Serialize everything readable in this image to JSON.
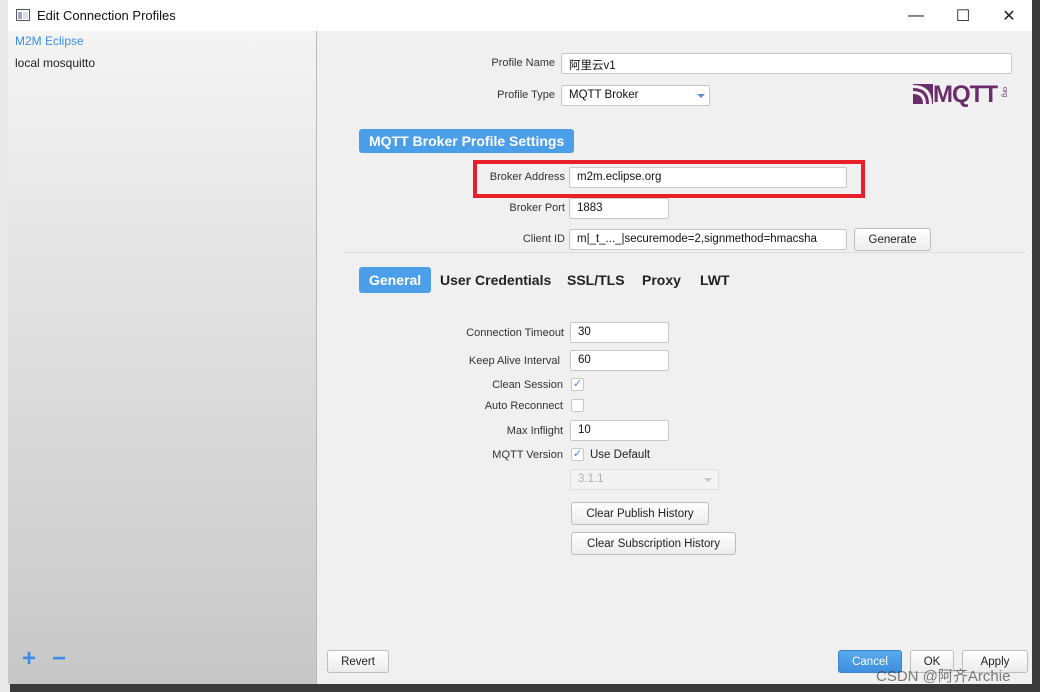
{
  "window": {
    "title": "Edit Connection Profiles",
    "minimize_glyph": "—",
    "maximize_glyph": "☐",
    "close_glyph": "✕"
  },
  "sidebar": {
    "profiles": [
      {
        "name": "M2M Eclipse",
        "selected": true
      },
      {
        "name": "local mosquitto",
        "selected": false
      }
    ],
    "add_glyph": "+",
    "remove_glyph": "−"
  },
  "profile": {
    "name_label": "Profile Name",
    "name_value": "阿里云v1",
    "type_label": "Profile Type",
    "type_value": "MQTT Broker"
  },
  "logo": {
    "text": "MQTT",
    "small": "org"
  },
  "section": {
    "title": "MQTT Broker Profile Settings"
  },
  "broker": {
    "address_label": "Broker Address",
    "address_value": "m2m.eclipse.org",
    "port_label": "Broker Port",
    "port_value": "1883",
    "client_id_label": "Client ID",
    "client_id_value": "m|_t_..._|securemode=2,signmethod=hmacsha",
    "generate_label": "Generate"
  },
  "tabs": [
    "General",
    "User Credentials",
    "SSL/TLS",
    "Proxy",
    "LWT"
  ],
  "general": {
    "connection_timeout_label": "Connection Timeout",
    "connection_timeout_value": "30",
    "keep_alive_label": "Keep Alive Interval",
    "keep_alive_value": "60",
    "clean_session_label": "Clean Session",
    "clean_session_checked": true,
    "auto_reconnect_label": "Auto Reconnect",
    "auto_reconnect_checked": false,
    "max_inflight_label": "Max Inflight",
    "max_inflight_value": "10",
    "mqtt_version_label": "MQTT Version",
    "use_default_label": "Use Default",
    "use_default_checked": true,
    "version_value": "3.1.1",
    "check_glyph": "✓",
    "clear_publish_label": "Clear Publish History",
    "clear_subscription_label": "Clear Subscription History"
  },
  "footer": {
    "revert_label": "Revert",
    "cancel_label": "Cancel",
    "ok_label": "OK",
    "apply_label": "Apply"
  },
  "watermark": "CSDN @阿齐Archie",
  "colors": {
    "accent": "#4b9ee8",
    "highlight_border": "#e8202a"
  }
}
